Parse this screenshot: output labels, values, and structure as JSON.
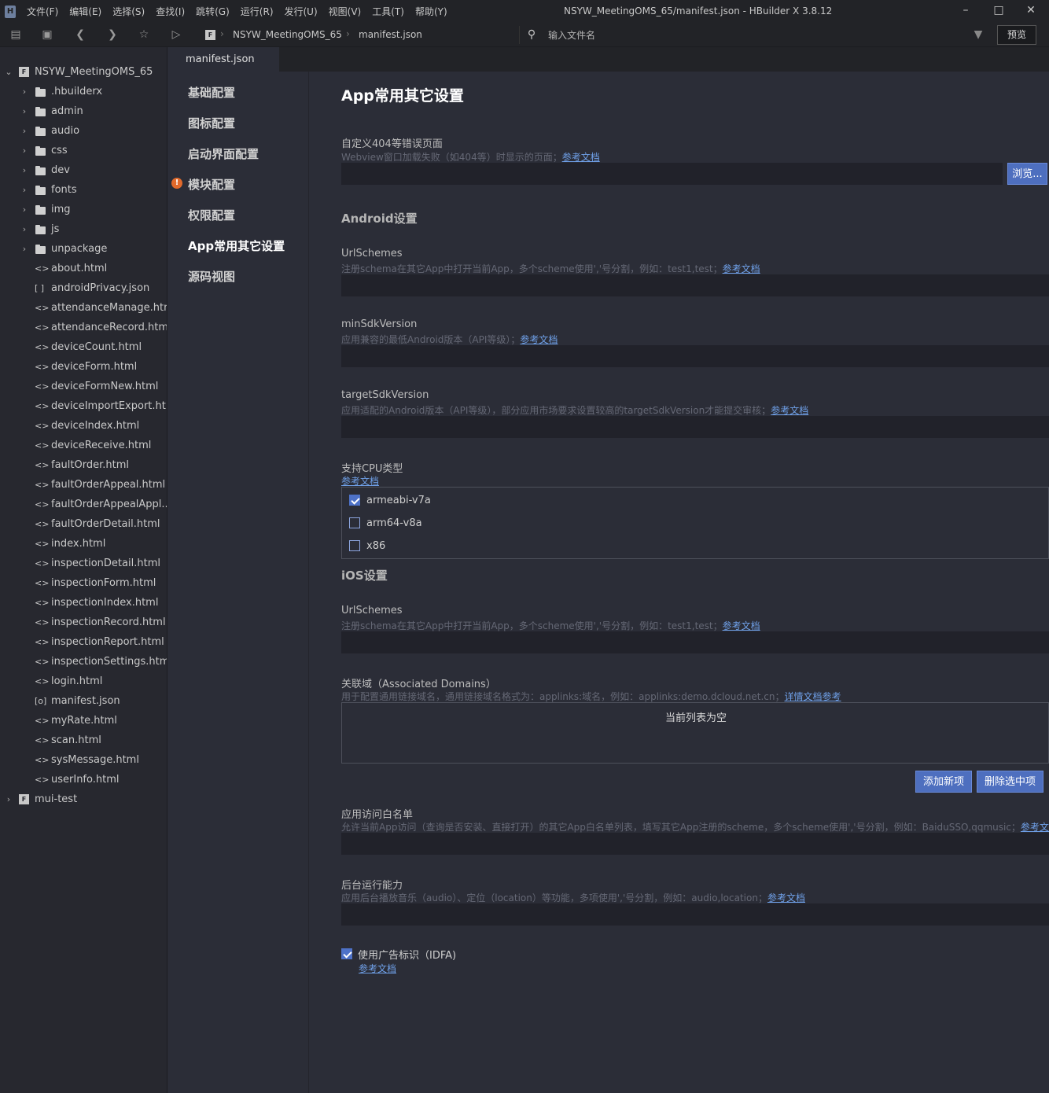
{
  "titlebar": {
    "menus": [
      "文件(F)",
      "编辑(E)",
      "选择(S)",
      "查找(I)",
      "跳转(G)",
      "运行(R)",
      "发行(U)",
      "视图(V)",
      "工具(T)",
      "帮助(Y)"
    ],
    "window_title": "NSYW_MeetingOMS_65/manifest.json - HBuilder X 3.8.12"
  },
  "toolbar": {
    "breadcrumb_project": "NSYW_MeetingOMS_65",
    "breadcrumb_file": "manifest.json",
    "file_search_placeholder": "输入文件名",
    "preview_label": "预览"
  },
  "sidebar": {
    "project": "NSYW_MeetingOMS_65",
    "folders": [
      ".hbuilderx",
      "admin",
      "audio",
      "css",
      "dev",
      "fonts",
      "img",
      "js",
      "unpackage"
    ],
    "files": [
      {
        "icon": "<>",
        "name": "about.html"
      },
      {
        "icon": "[ ]",
        "name": "androidPrivacy.json"
      },
      {
        "icon": "<>",
        "name": "attendanceManage.html"
      },
      {
        "icon": "<>",
        "name": "attendanceRecord.html"
      },
      {
        "icon": "<>",
        "name": "deviceCount.html"
      },
      {
        "icon": "<>",
        "name": "deviceForm.html"
      },
      {
        "icon": "<>",
        "name": "deviceFormNew.html"
      },
      {
        "icon": "<>",
        "name": "deviceImportExport.ht..."
      },
      {
        "icon": "<>",
        "name": "deviceIndex.html"
      },
      {
        "icon": "<>",
        "name": "deviceReceive.html"
      },
      {
        "icon": "<>",
        "name": "faultOrder.html"
      },
      {
        "icon": "<>",
        "name": "faultOrderAppeal.html"
      },
      {
        "icon": "<>",
        "name": "faultOrderAppealAppl..."
      },
      {
        "icon": "<>",
        "name": "faultOrderDetail.html"
      },
      {
        "icon": "<>",
        "name": "index.html"
      },
      {
        "icon": "<>",
        "name": "inspectionDetail.html"
      },
      {
        "icon": "<>",
        "name": "inspectionForm.html"
      },
      {
        "icon": "<>",
        "name": "inspectionIndex.html"
      },
      {
        "icon": "<>",
        "name": "inspectionRecord.html"
      },
      {
        "icon": "<>",
        "name": "inspectionReport.html"
      },
      {
        "icon": "<>",
        "name": "inspectionSettings.html"
      },
      {
        "icon": "<>",
        "name": "login.html"
      },
      {
        "icon": "[o]",
        "name": "manifest.json"
      },
      {
        "icon": "<>",
        "name": "myRate.html"
      },
      {
        "icon": "<>",
        "name": "scan.html"
      },
      {
        "icon": "<>",
        "name": "sysMessage.html"
      },
      {
        "icon": "<>",
        "name": "userInfo.html"
      }
    ],
    "second_project": "mui-test"
  },
  "tab": {
    "label": "manifest.json"
  },
  "config_nav": {
    "items": [
      "基础配置",
      "图标配置",
      "启动界面配置",
      "模块配置",
      "权限配置",
      "App常用其它设置",
      "源码视图"
    ],
    "active_index": 5,
    "warning_index": 3
  },
  "main": {
    "heading": "App常用其它设置",
    "error_page": {
      "label": "自定义404等错误页面",
      "hint": "Webview窗口加载失败（如404等）时显示的页面；",
      "link": "参考文档",
      "value": "",
      "browse_label": "浏览..."
    },
    "android_heading": "Android设置",
    "android_url_schemes": {
      "label": "UrlSchemes",
      "hint": "注册schema在其它App中打开当前App，多个scheme使用','号分割，例如：test1,test；",
      "link": "参考文档",
      "value": ""
    },
    "min_sdk": {
      "label": "minSdkVersion",
      "hint": "应用兼容的最低Android版本（API等级）；",
      "link": "参考文档",
      "value": ""
    },
    "target_sdk": {
      "label": "targetSdkVersion",
      "hint": "应用适配的Android版本（API等级），部分应用市场要求设置较高的targetSdkVersion才能提交审核；",
      "link": "参考文档",
      "value": ""
    },
    "cpu": {
      "label": "支持CPU类型",
      "link": "参考文档",
      "options": [
        {
          "label": "armeabi-v7a",
          "checked": "true"
        },
        {
          "label": "arm64-v8a",
          "checked": "false"
        },
        {
          "label": "x86",
          "checked": "false"
        }
      ]
    },
    "ios_heading": "iOS设置",
    "ios_url_schemes": {
      "label": "UrlSchemes",
      "hint": "注册schema在其它App中打开当前App，多个scheme使用','号分割，例如：test1,test；",
      "link": "参考文档",
      "value": ""
    },
    "associated_domains": {
      "label": "关联域（Associated Domains）",
      "hint": "用于配置通用链接域名，通用链接域名格式为：applinks:域名，例如：applinks:demo.dcloud.net.cn；",
      "link": "详情文档参考",
      "empty_text": "当前列表为空",
      "add_label": "添加新项",
      "delete_label": "删除选中项"
    },
    "whitelist": {
      "label": "应用访问白名单",
      "hint": "允许当前App访问（查询是否安装、直接打开）的其它App白名单列表，填写其它App注册的scheme，多个scheme使用','号分割，例如：BaiduSSO,qqmusic；",
      "link": "参考文档",
      "value": ""
    },
    "background": {
      "label": "后台运行能力",
      "hint": "应用后台播放音乐（audio）、定位（location）等功能，多项使用','号分割，例如：audio,location；",
      "link": "参考文档",
      "value": ""
    },
    "idfa": {
      "label": "使用广告标识（IDFA)",
      "link": "参考文档",
      "checked": "true"
    }
  }
}
